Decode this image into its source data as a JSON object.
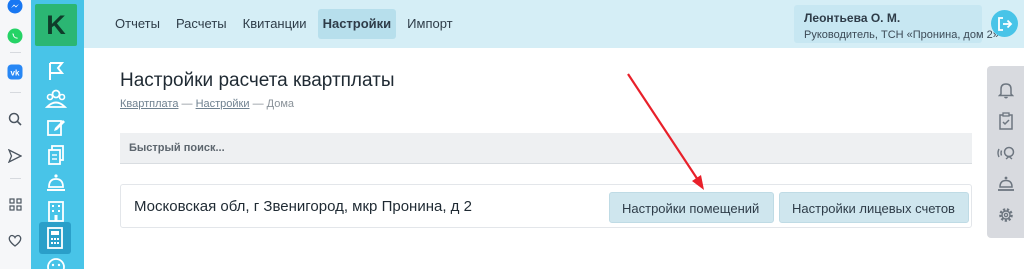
{
  "browser_sidebar": {
    "icons": [
      "messenger-icon",
      "whatsapp-icon",
      "vk-icon",
      "search-icon",
      "send-icon",
      "apps-icon",
      "heart-icon"
    ],
    "colors": {
      "messenger": "#1877f2",
      "whatsapp": "#25d366",
      "vk": "#2787f5",
      "gray": "#6b7580"
    }
  },
  "app": {
    "logo_letter": "K",
    "nav_icons": [
      "flag-icon",
      "people-icon",
      "edit-icon",
      "documents-icon",
      "service-bell-icon",
      "building-icon",
      "calculator-icon",
      "smile-icon"
    ],
    "active_nav": "calculator-icon",
    "colors": {
      "nav_bg": "#48c4e8",
      "logo_bg": "#2bb673",
      "header_bg": "#d5eef6"
    }
  },
  "header": {
    "menu": [
      {
        "label": "Отчеты"
      },
      {
        "label": "Расчеты"
      },
      {
        "label": "Квитанции"
      },
      {
        "label": "Настройки",
        "active": true
      },
      {
        "label": "Импорт"
      }
    ],
    "user_name": "Леонтьева О. М.",
    "user_role": "Руководитель, ТСН «Пронина, дом 2»"
  },
  "right_panel": {
    "icons": [
      "bell-icon",
      "clipboard-check-icon",
      "support-icon",
      "service-bell-icon",
      "settings-gear-icon"
    ]
  },
  "main": {
    "title": "Настройки расчета квартплаты",
    "breadcrumb": {
      "items": [
        "Квартплата",
        "Настройки",
        "Дома"
      ],
      "separator": "—"
    },
    "search": {
      "placeholder": "Быстрый поиск...",
      "value": ""
    },
    "houses": [
      {
        "address": "Московская обл, г Звенигород, мкр Пронина, д 2",
        "buttons": [
          "Настройки помещений",
          "Настройки лицевых счетов"
        ]
      }
    ]
  },
  "annotation": {
    "arrow_color": "#e8202a"
  }
}
